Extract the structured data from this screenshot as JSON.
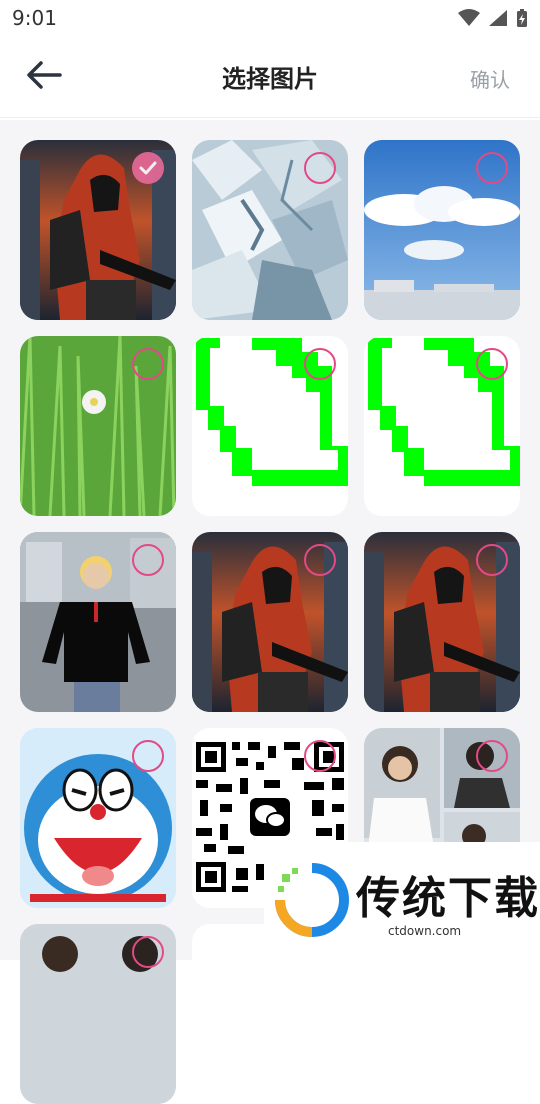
{
  "status_bar": {
    "time": "9:01"
  },
  "header": {
    "title": "选择图片",
    "confirm_label": "确认"
  },
  "colors": {
    "accent": "#e24a86",
    "green_shape": "#00ff00"
  },
  "tiles": [
    {
      "kind": "soldier-photo",
      "selected": true
    },
    {
      "kind": "ice-photo",
      "selected": false
    },
    {
      "kind": "sky-clouds-photo",
      "selected": false
    },
    {
      "kind": "grass-flower-photo",
      "selected": false
    },
    {
      "kind": "green-pixel-outline",
      "selected": false
    },
    {
      "kind": "green-pixel-outline",
      "selected": false
    },
    {
      "kind": "cartoon-man-photo",
      "selected": false
    },
    {
      "kind": "soldier-photo",
      "selected": false
    },
    {
      "kind": "soldier-photo",
      "selected": false
    },
    {
      "kind": "doraemon-cartoon",
      "selected": false
    },
    {
      "kind": "qr-code",
      "selected": false
    },
    {
      "kind": "woman-collage-photo",
      "selected": false
    }
  ],
  "watermark": {
    "text": "传统下载",
    "url": "ctdown.com"
  }
}
